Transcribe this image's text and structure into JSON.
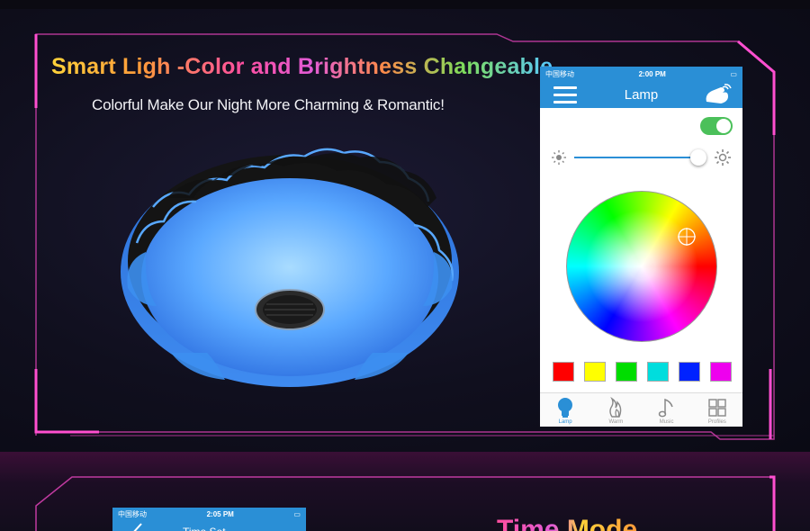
{
  "hero": {
    "title": "Smart Ligh -Color and Brightness Changeable",
    "subtitle": "Colorful Make Our Night More Charming & Romantic!"
  },
  "phone": {
    "status": {
      "carrier": "中国移动",
      "time": "2:00 PM"
    },
    "title": "Lamp",
    "power_on": true,
    "brightness": 0.95,
    "swatch_colors": [
      "#ff0000",
      "#ffff00",
      "#00dd00",
      "#00dddd",
      "#0022ff",
      "#ee00ee"
    ],
    "tabs": [
      {
        "label": "Lamp",
        "icon": "bulb-icon",
        "active": true
      },
      {
        "label": "Warm",
        "icon": "flame-icon",
        "active": false
      },
      {
        "label": "Music",
        "icon": "music-note-icon",
        "active": false
      },
      {
        "label": "Profiles",
        "icon": "grid-icon",
        "active": false
      }
    ]
  },
  "bottom": {
    "status": {
      "carrier": "中国移动",
      "time": "2:05 PM"
    },
    "title": "Time Set",
    "headline": "Time Mode"
  },
  "colors": {
    "accent": "#2a8fd6",
    "frame": "#c03aa0"
  }
}
